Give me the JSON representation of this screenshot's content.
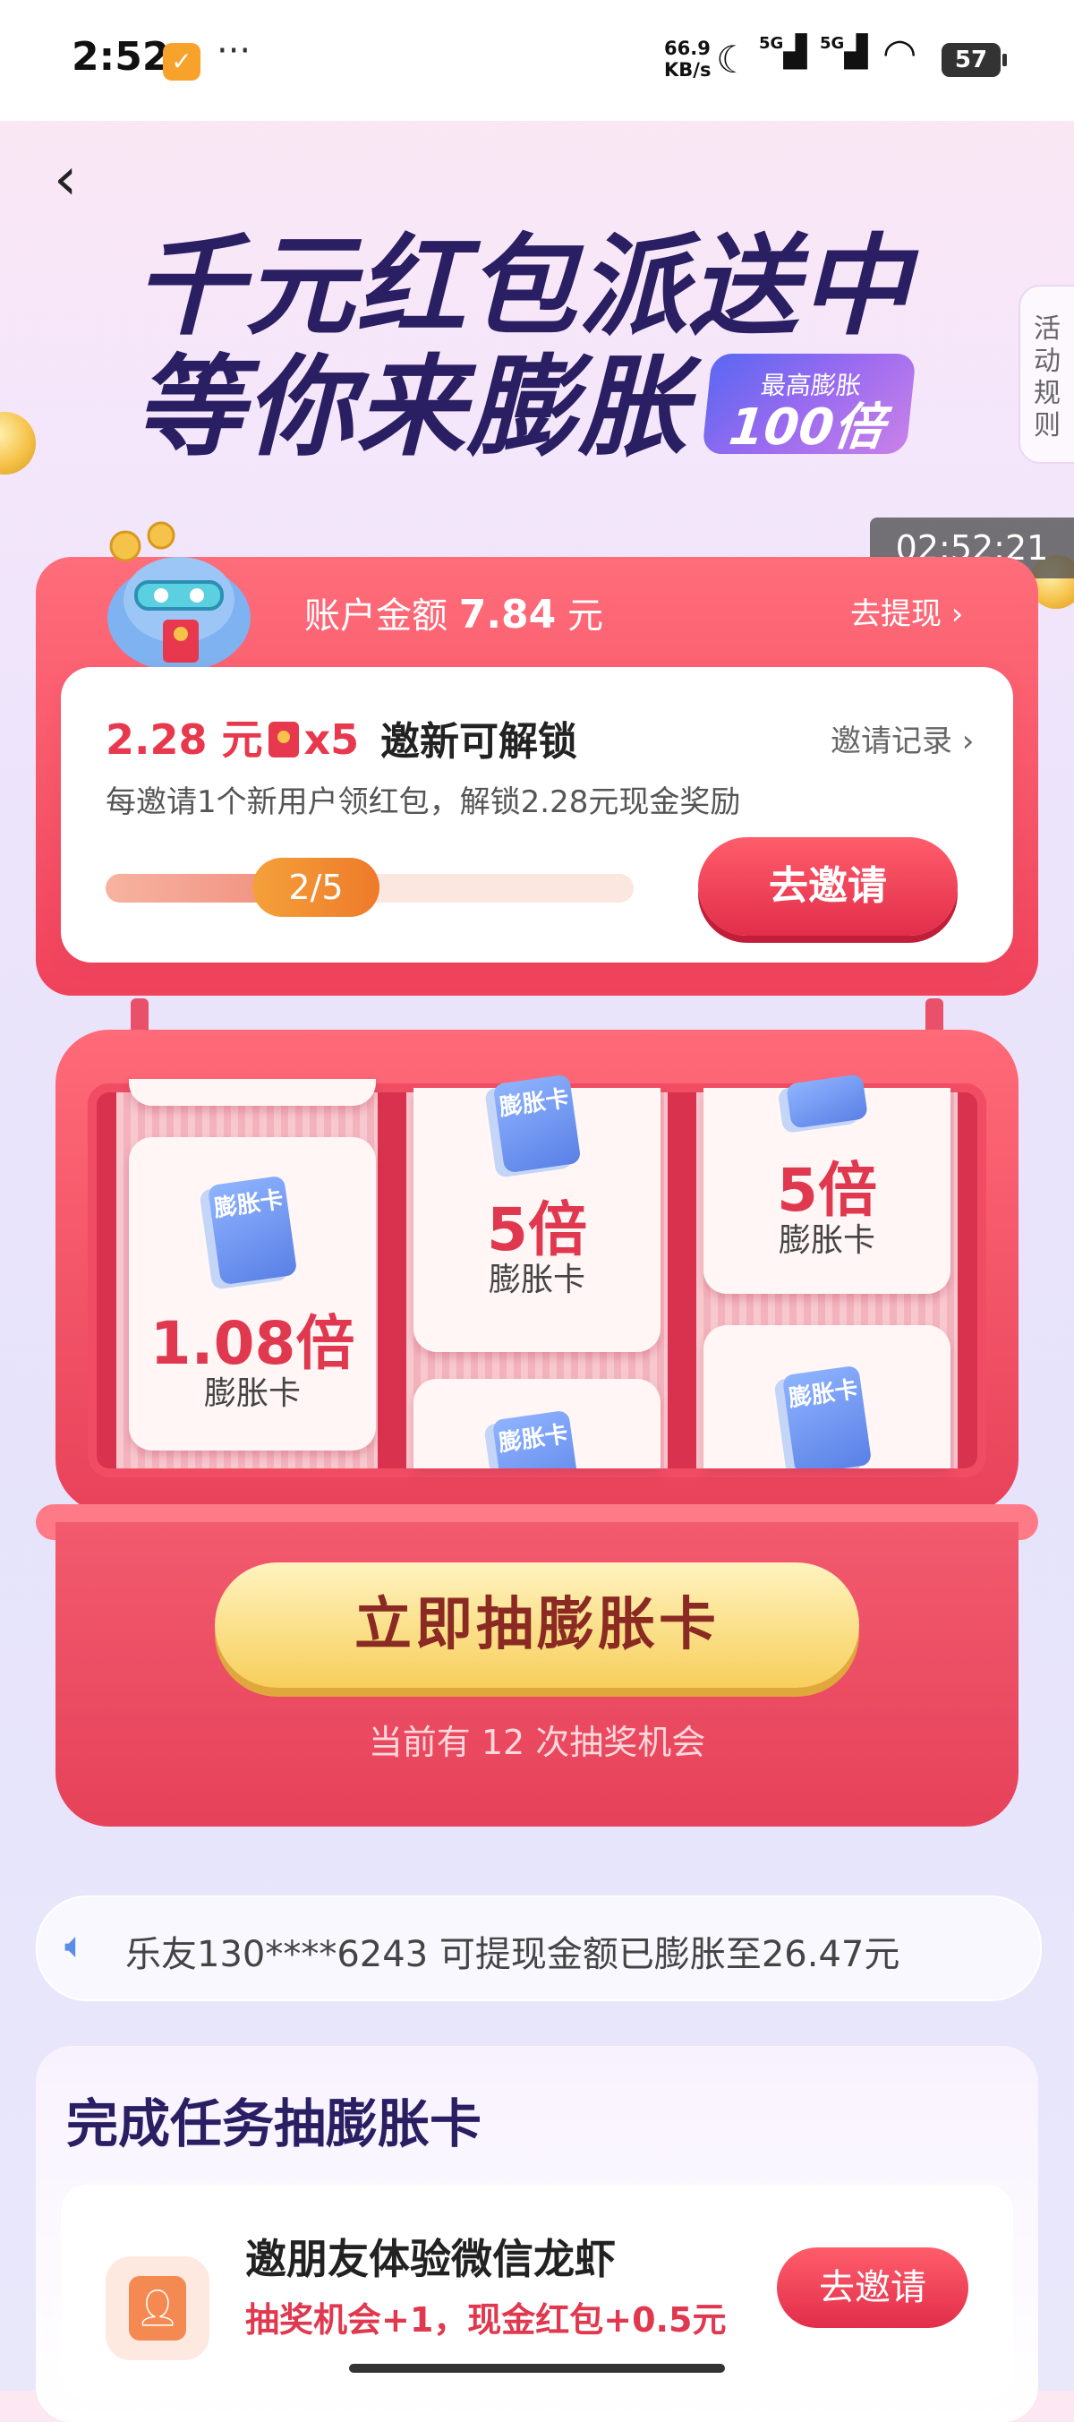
{
  "status_bar": {
    "time": "2:52",
    "more": "···",
    "net_speed": "66.9 KB/s",
    "net_speed_value": "66.9",
    "net_speed_unit": "KB/s",
    "sim1": "5G",
    "sim2": "5G",
    "battery": "57"
  },
  "header": {
    "back_icon": "chevron-left",
    "title_line1": "千元红包派送中",
    "title_line2": "等你来膨胀",
    "badge_top": "最高膨胀",
    "badge_value": "100倍",
    "rules_label": "活动规则",
    "timer": "02:52:21"
  },
  "account": {
    "label": "账户金额",
    "amount": "7.84",
    "unit": "元",
    "withdraw_label": "去提现 ›",
    "reward_amount": "2.28 元",
    "reward_times": "x5",
    "unlock_label": "邀新可解锁",
    "invite_record_label": "邀请记录 ›",
    "description": "每邀请1个新用户领红包，解锁2.28元现金奖励",
    "progress_text": "2/5",
    "progress_fraction": 0.4,
    "invite_button": "去邀请"
  },
  "machine": {
    "cards": [
      {
        "multiplier": "1.08倍",
        "name": "膨胀卡",
        "icon": "膨胀卡"
      },
      {
        "multiplier": "5倍",
        "name": "膨胀卡",
        "icon": "膨胀卡"
      },
      {
        "multiplier": "5倍",
        "name": "膨胀卡",
        "icon": "膨胀卡"
      }
    ],
    "partial_icon_text": "膨胀卡",
    "draw_button": "立即抽膨胀卡",
    "chances_text": "当前有 12 次抽奖机会"
  },
  "ticker": {
    "icon": "speaker-icon",
    "text": "乐友130****6243 可提现金额已膨胀至26.47元"
  },
  "tasks": {
    "title": "完成任务抽膨胀卡",
    "items": [
      {
        "title": "邀朋友体验微信龙虾",
        "reward": "抽奖机会+1，现金红包+0.5元",
        "button": "去邀请"
      }
    ]
  },
  "colors": {
    "primary_red": "#e8384d",
    "title_navy": "#2a1f63",
    "gold": "#f7cf5c"
  }
}
